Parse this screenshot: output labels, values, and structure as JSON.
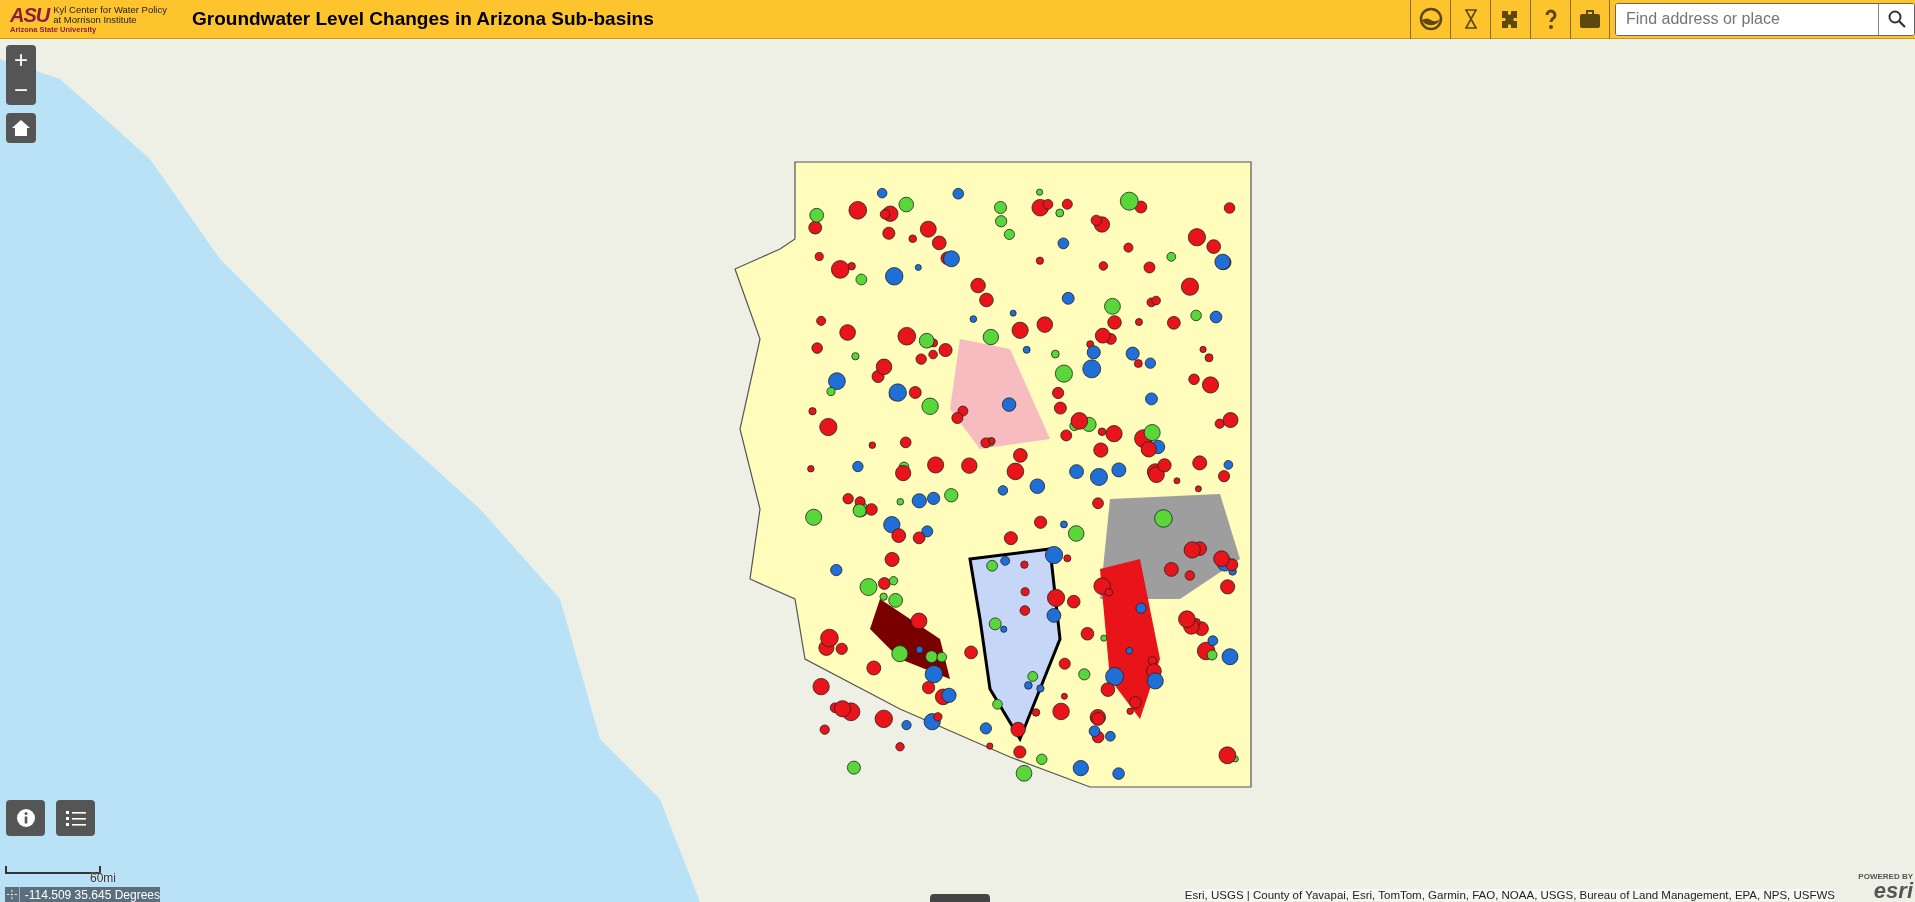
{
  "header": {
    "logo_mark": "ASU",
    "logo_line_1": "Kyl Center for Water Policy",
    "logo_line_2": "at Morrison Institute",
    "logo_university": "Arizona State University",
    "title": "Groundwater Level Changes in Arizona Sub-basins"
  },
  "search": {
    "placeholder": "Find address or place"
  },
  "map": {
    "zoom_in": "+",
    "zoom_out": "−",
    "scale": "60mi",
    "coordinates": "-114.509 35.645 Degrees",
    "attribution": "Esri, USGS | County of Yavapai, Esri, TomTom, Garmin, FAO, NOAA, USGS, Bureau of Land Management, EPA, NPS, USFWS",
    "powered_by": "POWERED BY",
    "esri": "esri"
  }
}
